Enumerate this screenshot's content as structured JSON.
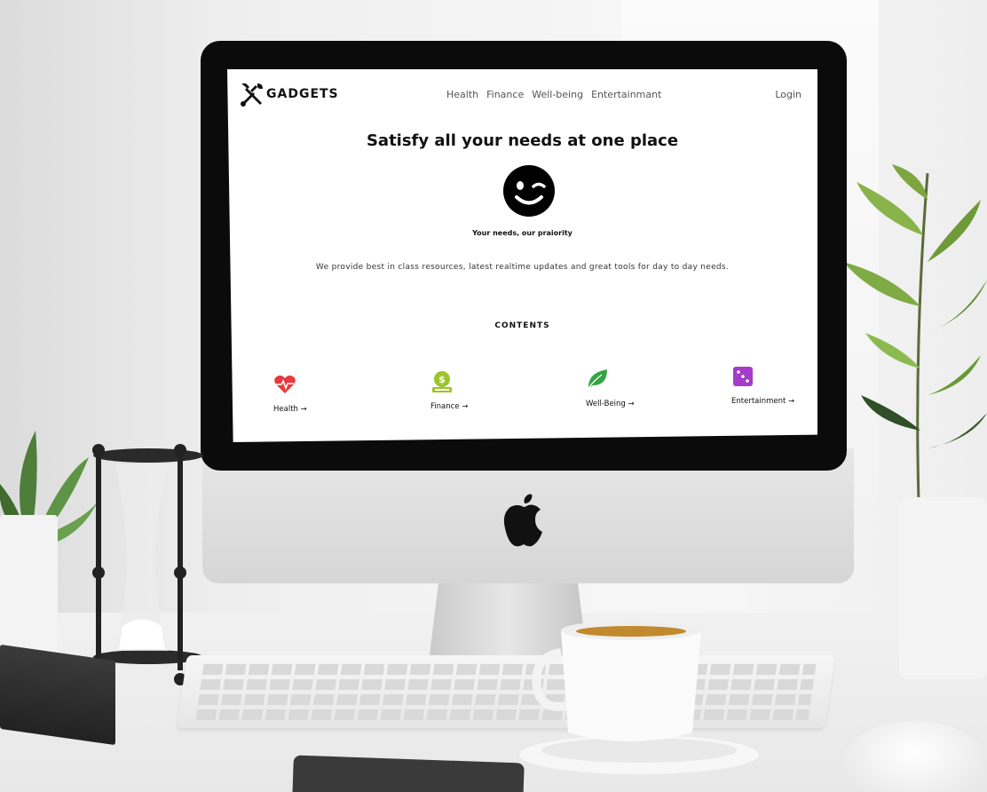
{
  "brand": {
    "name": "GADGETS",
    "logo_icon": "wrench-screwdriver-icon"
  },
  "nav": {
    "links": [
      "Health",
      "Finance",
      "Well-being",
      "Entertainmant"
    ],
    "login": "Login"
  },
  "hero": {
    "title": "Satisfy all your needs at one place",
    "emoji_icon": "winking-face-icon",
    "tagline": "Your needs, our praiority",
    "description": "We provide best in class resources, latest realtime updates and great tools for day to day needs."
  },
  "contents": {
    "heading": "CONTENTS",
    "items": [
      {
        "label": "Health →",
        "icon": "heart-pulse-icon",
        "color": "#e8393d"
      },
      {
        "label": "Finance →",
        "icon": "money-bag-icon",
        "color": "#9cc42b"
      },
      {
        "label": "Well-Being →",
        "icon": "leaf-icon",
        "color": "#35a444"
      },
      {
        "label": "Entertainment →",
        "icon": "dice-icon",
        "color": "#a33cc9"
      }
    ]
  }
}
